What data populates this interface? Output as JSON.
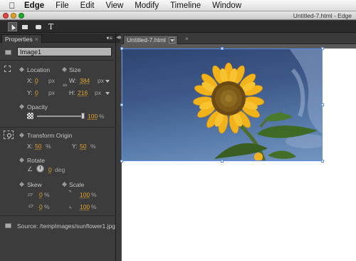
{
  "menubar": {
    "apple": "",
    "app": "Edge",
    "items": [
      "File",
      "Edit",
      "View",
      "Modify",
      "Timeline",
      "Window"
    ]
  },
  "window": {
    "title": "Untitled-7.html - Edge"
  },
  "toolbar": {
    "tools": [
      "selection-tool",
      "rectangle-tool",
      "rounded-rectangle-tool",
      "text-tool"
    ],
    "text_tool_glyph": "T"
  },
  "properties": {
    "tab_label": "Properties",
    "tab_close": "×",
    "element_name": "Image1",
    "location": {
      "label": "Location",
      "x_label": "X:",
      "x_value": "0",
      "x_unit": "px",
      "y_label": "Y:",
      "y_value": "0",
      "y_unit": "px"
    },
    "size": {
      "label": "Size",
      "w_label": "W:",
      "w_value": "384",
      "w_unit": "px",
      "h_label": "H:",
      "h_value": "216",
      "h_unit": "px"
    },
    "opacity": {
      "label": "Opacity",
      "value": "100",
      "unit": "%",
      "level": 1.0
    },
    "transform_origin": {
      "label": "Transform Origin",
      "x_label": "X:",
      "x_value": "50",
      "x_unit": "%",
      "y_label": "Y:",
      "y_value": "50",
      "y_unit": "%"
    },
    "rotate": {
      "label": "Rotate",
      "value": "0",
      "unit": "deg"
    },
    "skew": {
      "label": "Skew",
      "x_value": "0",
      "x_unit": "%",
      "y_value": "0",
      "y_unit": "%"
    },
    "scale": {
      "label": "Scale",
      "x_value": "100",
      "x_unit": "%",
      "y_value": "100",
      "y_unit": "%"
    },
    "source": "Source: /tempImages/sunflower1.jpg"
  },
  "document": {
    "tab_label": "Untitled-7.html",
    "tab_close": "×"
  },
  "colors": {
    "selection": "#5b8de8",
    "value_orange": "#e0a42c",
    "sky": "#3e5a8a",
    "petals": "#f2b21a"
  }
}
